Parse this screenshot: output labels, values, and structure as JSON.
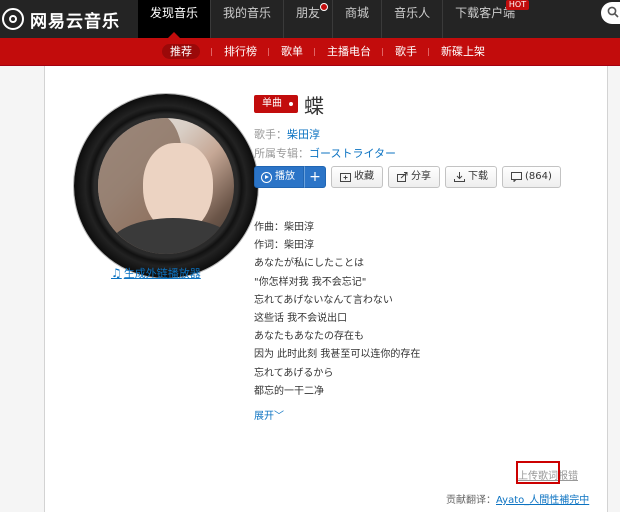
{
  "header": {
    "logo_text": "网易云音乐",
    "nav": [
      {
        "label": "发现音乐",
        "active": true
      },
      {
        "label": "我的音乐"
      },
      {
        "label": "朋友",
        "dot": true
      },
      {
        "label": "商城"
      },
      {
        "label": "音乐人"
      },
      {
        "label": "下载客户端",
        "badge": "HOT"
      }
    ],
    "subnav": [
      "推荐",
      "排行榜",
      "歌单",
      "主播电台",
      "歌手",
      "新碟上架"
    ]
  },
  "song": {
    "tag": "单曲",
    "title": "蝶",
    "artist_label": "歌手：",
    "artist": "柴田淳",
    "album_label": "所属专辑：",
    "album": "ゴーストライター",
    "gen_player_link": "生成外链播放器"
  },
  "actions": {
    "play": "播放",
    "plus": "+",
    "collect": "收藏",
    "share": "分享",
    "download": "下载",
    "comments": "(864)"
  },
  "lyrics": [
    "作曲：柴田淳",
    "作词：柴田淳",
    "あなたが私にしたことは",
    "\"你怎样对我 我不会忘记\"",
    "忘れてあげないなんて言わない",
    "这些话 我不会说出口",
    "あなたもあなたの存在も",
    "因为 此时此刻 我甚至可以连你的存在",
    "忘れてあげるから",
    "都忘的一干二净"
  ],
  "footer": {
    "expand": "展开",
    "upload": "上传歌词",
    "report": "报错",
    "credit_label": "贡献翻译：",
    "credit_user": "Ayato_人間性補完中"
  },
  "colors": {
    "brand_red": "#c20c0c",
    "link_blue": "#0c73c2",
    "play_blue": "#2b74c7"
  }
}
